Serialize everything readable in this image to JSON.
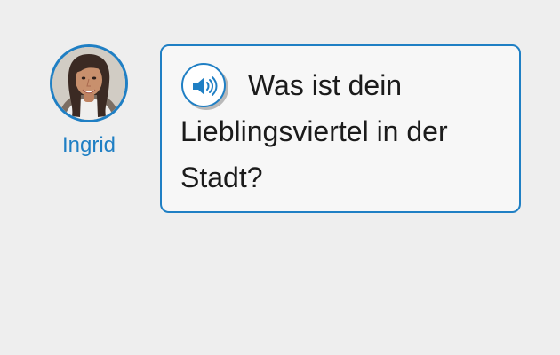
{
  "speaker": {
    "name": "Ingrid"
  },
  "prompt": {
    "question": "Was ist dein Lieblingsviertel in der Stadt?",
    "audio_icon": "speaker-volume-icon"
  },
  "colors": {
    "accent": "#1f7fc4",
    "background": "#eeeeee",
    "bubble_background": "#f7f7f7"
  }
}
